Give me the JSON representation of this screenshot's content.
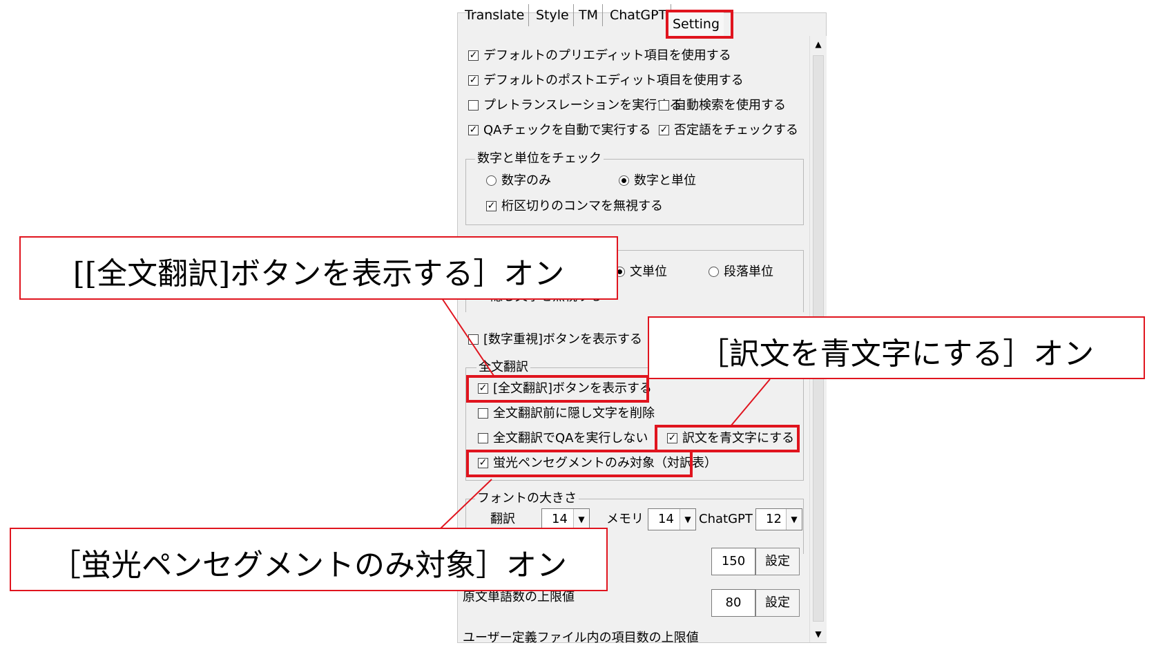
{
  "tabs": [
    "Translate",
    "Style",
    "TM",
    "ChatGPT",
    "Setting"
  ],
  "options": {
    "use_default_preedit": "デフォルトのプリエディット項目を使用する",
    "use_default_postedit": "デフォルトのポストエディット項目を使用する",
    "run_pretranslation": "プレトランスレーションを実行する",
    "use_auto_search": "自動検索を使用する",
    "auto_qa_check": "QAチェックを自動で実行する",
    "check_negation": "否定語をチェックする"
  },
  "number_unit_group": {
    "label": "数字と単位をチェック",
    "numbers_only": "数字のみ",
    "numbers_and_units": "数字と単位",
    "ignore_commas": "桁区切りのコンマを無視する"
  },
  "unit_group": {
    "sentence_unit": "文単位",
    "paragraph_unit": "段落単位",
    "ignore_hidden_text": "隠し文字を無視する"
  },
  "show_number_button": "[数字重視]ボタンを表示する",
  "full_translation_group": {
    "label": "全文翻訳",
    "show_full_button": "[全文翻訳]ボタンを表示する",
    "delete_hidden_text": "全文翻訳前に隠し文字を削除",
    "no_qa": "全文翻訳でQAを実行しない",
    "blue_text": "訳文を青文字にする",
    "highlight_only": "蛍光ペンセグメントのみ対象（対訳表）"
  },
  "font_group": {
    "label": "フォントの大きさ",
    "translation_label": "翻訳",
    "translation_value": "14",
    "memory_label": "メモリ",
    "memory_value": "14",
    "chatgpt_label": "ChatGPT",
    "chatgpt_value": "12"
  },
  "limits": {
    "first_value": "150",
    "source_word_label": "原文単語数の上限値",
    "source_word_value": "80",
    "user_file_label": "ユーザー定義ファイル内の項目数の上限値",
    "set_label": "設定"
  },
  "callouts": {
    "full_translation": "[[全文翻訳]ボタンを表示する］オン",
    "blue_text": "［訳文を青文字にする］オン",
    "highlight": "［蛍光ペンセグメントのみ対象］オン"
  },
  "colors": {
    "highlight": "#e0141e",
    "panel": "#f0f0f0"
  }
}
